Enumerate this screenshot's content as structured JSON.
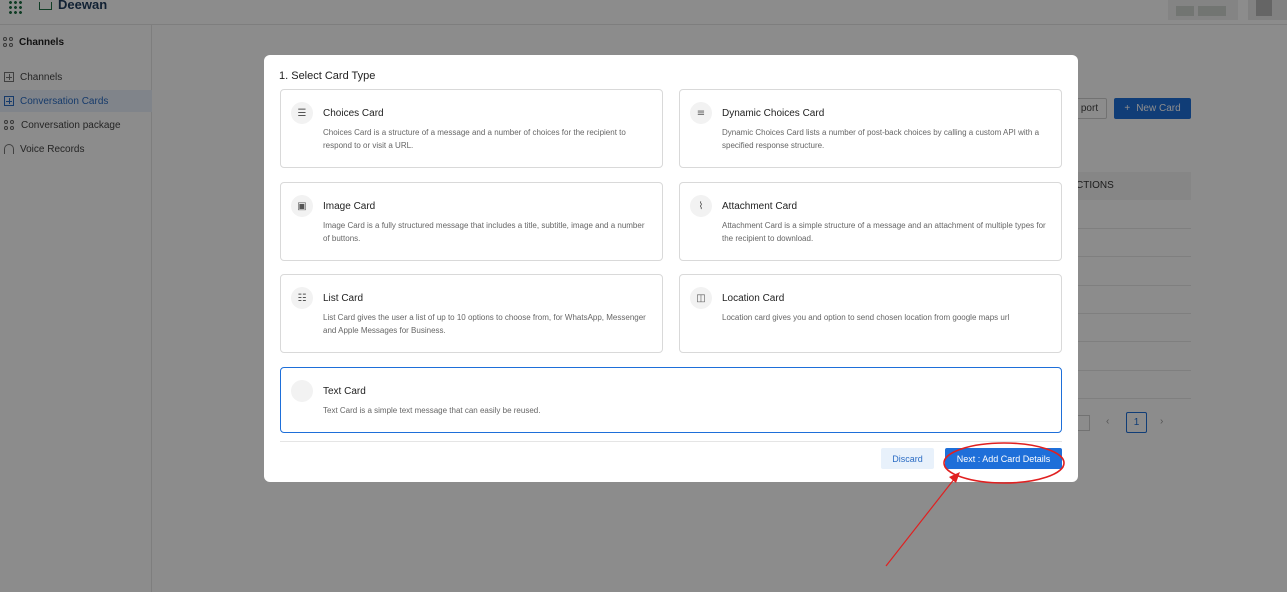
{
  "app": {
    "brand": "Deewan"
  },
  "sidebar": {
    "section_title": "Channels",
    "items": [
      {
        "label": "Channels",
        "icon": "plus-box-icon"
      },
      {
        "label": "Conversation Cards",
        "icon": "plus-box-icon",
        "active": true
      },
      {
        "label": "Conversation package",
        "icon": "grid-icon"
      },
      {
        "label": "Voice Records",
        "icon": "voice-icon"
      }
    ]
  },
  "background": {
    "export_label": "port",
    "new_card_label": "New Card",
    "table_header": "CTIONS",
    "page_number": "1"
  },
  "modal": {
    "title": "1. Select Card Type",
    "cards": [
      {
        "title": "Choices Card",
        "description": "Choices Card is a structure of a message and a number of choices for the recipient to respond to or visit a URL.",
        "icon": "list-numbered-icon"
      },
      {
        "title": "Dynamic Choices Card",
        "description": "Dynamic Choices Card lists a number of post-back choices by calling a custom API with a specified response structure.",
        "icon": "menu-lines-icon"
      },
      {
        "title": "Image Card",
        "description": "Image Card is a fully structured message that includes a title, subtitle, image and a number of buttons.",
        "icon": "image-icon"
      },
      {
        "title": "Attachment Card",
        "description": "Attachment Card is a simple structure of a message and an attachment of multiple types for the recipient to download.",
        "icon": "paperclip-icon"
      },
      {
        "title": "List Card",
        "description": "List Card gives the user a list of up to 10 options to choose from, for WhatsApp, Messenger and Apple Messages for Business.",
        "icon": "bullet-list-icon"
      },
      {
        "title": "Location Card",
        "description": "Location card gives you and option to send chosen location from google maps url",
        "icon": "map-icon"
      },
      {
        "title": "Text Card",
        "description": "Text Card is a simple text message that can easily be reused.",
        "icon": "text-icon",
        "selected": true
      }
    ],
    "discard_label": "Discard",
    "next_label": "Next : Add Card Details"
  },
  "colors": {
    "accent": "#1e6fd9",
    "annotation": "#e02020"
  }
}
